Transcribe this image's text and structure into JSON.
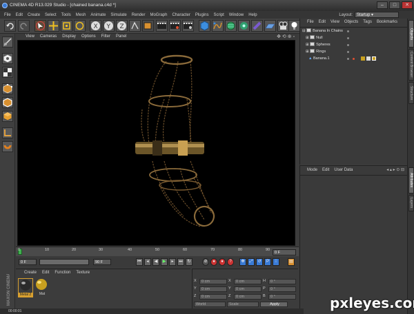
{
  "titlebar": {
    "title": "CINEMA 4D R13.029 Studio - [chained banana.c4d *]"
  },
  "menubar": {
    "items": [
      "File",
      "Edit",
      "Create",
      "Select",
      "Tools",
      "Mesh",
      "Animate",
      "Simulate",
      "Render",
      "MoGraph",
      "Character",
      "Plugins",
      "Script",
      "Window",
      "Help"
    ],
    "layout_label": "Layout:",
    "layout_value": "Startup"
  },
  "viewport_menu": {
    "items": [
      "View",
      "Cameras",
      "Display",
      "Options",
      "Filter",
      "Panel"
    ]
  },
  "timeline": {
    "ticks": [
      "0",
      "10",
      "20",
      "30",
      "40",
      "50",
      "60",
      "70",
      "80",
      "90"
    ],
    "end_field": "0 F"
  },
  "transport": {
    "start_field": "0 F",
    "end_field": "90 F",
    "min_field": "0 F",
    "max_field": "90 F"
  },
  "material_panel": {
    "menu": [
      "Create",
      "Edit",
      "Function",
      "Texture"
    ],
    "materials": [
      {
        "label": "Metal 2"
      },
      {
        "label": "Mat"
      }
    ]
  },
  "coord_panel": {
    "rows": [
      {
        "a": "X",
        "v1": "0 cm",
        "b": "X",
        "v2": "0 cm",
        "c": "H",
        "v3": "0 °"
      },
      {
        "a": "Y",
        "v1": "0 cm",
        "b": "Y",
        "v2": "0 cm",
        "c": "P",
        "v3": "0 °"
      },
      {
        "a": "Z",
        "v1": "0 cm",
        "b": "Z",
        "v2": "0 cm",
        "c": "B",
        "v3": "0 °"
      }
    ],
    "mode_select": "World",
    "scale_select": "Scale",
    "apply_label": "Apply"
  },
  "object_panel": {
    "menu": [
      "File",
      "Edit",
      "View",
      "Objects",
      "Tags",
      "Bookmarks"
    ],
    "objects": [
      {
        "name": "Banana In Chains",
        "indent": 0
      },
      {
        "name": "Null",
        "indent": 1
      },
      {
        "name": "Spheres",
        "indent": 1
      },
      {
        "name": "Rings",
        "indent": 1
      },
      {
        "name": "Banana.1",
        "indent": 1
      }
    ]
  },
  "attr_panel": {
    "menu": [
      "Mode",
      "Edit",
      "User Data"
    ]
  },
  "right_tabs": [
    "Objects",
    "Content Browser",
    "Structure",
    "Attributes",
    "Layers"
  ],
  "statusbar": {
    "text": "00:00:01"
  },
  "watermark": {
    "text": "pxleyes.com"
  },
  "brand": {
    "text": "MAXON CINEMA 4D"
  },
  "colors": {
    "accent": "#3a7bd5",
    "viewport_bg": "#000000",
    "chain": "#8a6a3a",
    "banana": "#c8a052"
  }
}
